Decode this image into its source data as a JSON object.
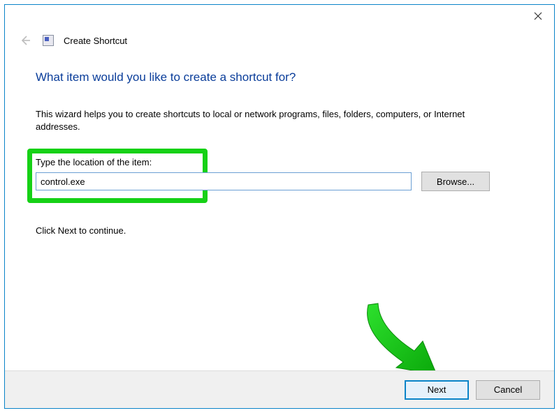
{
  "header": {
    "title": "Create Shortcut"
  },
  "main": {
    "heading": "What item would you like to create a shortcut for?",
    "description": "This wizard helps you to create shortcuts to local or network programs, files, folders, computers, or Internet addresses.",
    "location_label": "Type the location of the item:",
    "location_value": "control.exe",
    "browse_label": "Browse...",
    "continue_text": "Click Next to continue."
  },
  "footer": {
    "next_label": "Next",
    "cancel_label": "Cancel"
  },
  "annotation": {
    "highlight_color": "#16d116",
    "arrow_color": "#16d116"
  }
}
